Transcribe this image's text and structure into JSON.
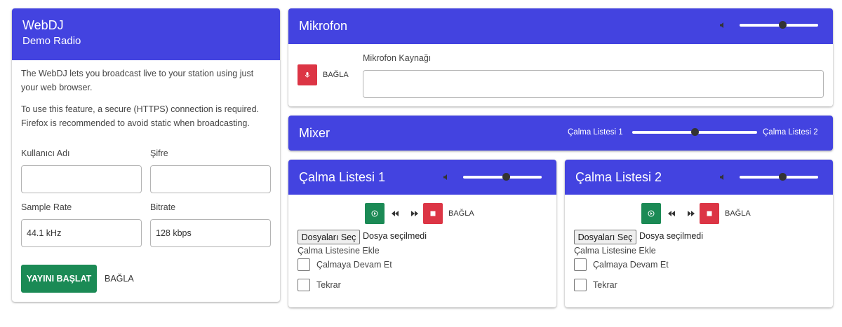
{
  "left": {
    "title": "WebDJ",
    "subtitle": "Demo Radio",
    "p1": "The WebDJ lets you broadcast live to your station using just your web browser.",
    "p2": "To use this feature, a secure (HTTPS) connection is required. Firefox is recommended to avoid static when broadcasting.",
    "username_label": "Kullanıcı Adı",
    "username_value": "",
    "password_label": "Şifre",
    "password_value": "",
    "sample_rate_label": "Sample Rate",
    "sample_rate_value": "44.1 kHz",
    "bitrate_label": "Bitrate",
    "bitrate_value": "128 kbps",
    "start_button": "YAYINI BAŞLAT",
    "connect_link": "BAĞLA"
  },
  "mic": {
    "title": "Mikrofon",
    "volume": 0.55,
    "connect_label": "BAĞLA",
    "source_label": "Mikrofon Kaynağı",
    "source_value": ""
  },
  "mixer": {
    "title": "Mixer",
    "left_label": "Çalma Listesi 1",
    "right_label": "Çalma Listesi 2",
    "position": 0.5
  },
  "playlists": [
    {
      "title": "Çalma Listesi 1",
      "volume": 0.55,
      "connect_label": "BAĞLA",
      "file_button": "Dosyaları Seç",
      "file_status": "Dosya seçilmedi",
      "add_label": "Çalma Listesine Ekle",
      "continue_label": "Çalmaya Devam Et",
      "repeat_label": "Tekrar"
    },
    {
      "title": "Çalma Listesi 2",
      "volume": 0.55,
      "connect_label": "BAĞLA",
      "file_button": "Dosyaları Seç",
      "file_status": "Dosya seçilmedi",
      "add_label": "Çalma Listesine Ekle",
      "continue_label": "Çalmaya Devam Et",
      "repeat_label": "Tekrar"
    }
  ],
  "colors": {
    "header": "#4343e0",
    "green": "#1b8a55",
    "red": "#dc3545"
  },
  "icons": [
    "microphone-icon",
    "speaker-icon",
    "play-icon",
    "rewind-icon",
    "fast-forward-icon",
    "stop-icon"
  ]
}
